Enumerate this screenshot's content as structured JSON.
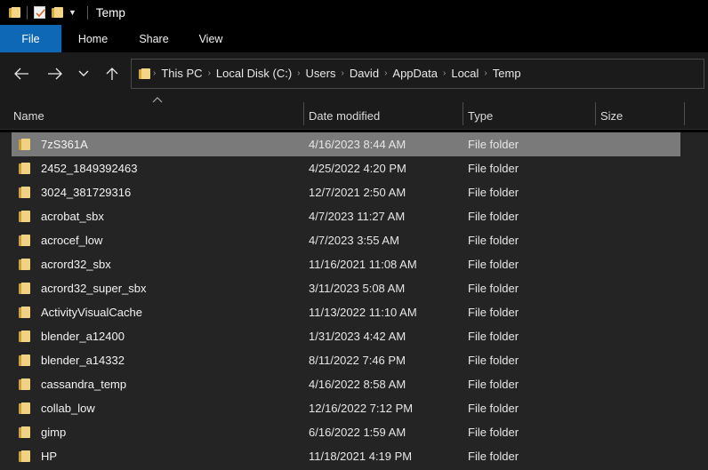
{
  "titlebar": {
    "title": "Temp",
    "quick_access": [
      {
        "icon": "folder-icon",
        "name": "explorer-app-icon"
      },
      {
        "icon": "properties-icon",
        "name": "properties-quick-access"
      },
      {
        "icon": "folder-icon",
        "name": "new-folder-quick-access"
      },
      {
        "icon": "chevron-down-icon",
        "name": "customize-quick-access"
      }
    ]
  },
  "ribbon": {
    "tabs": [
      {
        "label": "File",
        "active": true
      },
      {
        "label": "Home",
        "active": false
      },
      {
        "label": "Share",
        "active": false
      },
      {
        "label": "View",
        "active": false
      }
    ],
    "accent_color": "#0f68b5"
  },
  "navigation": {
    "back_icon": "arrow-left-icon",
    "forward_icon": "arrow-right-icon",
    "recent_icon": "chevron-down-icon",
    "up_icon": "arrow-up-icon",
    "breadcrumbs": [
      "This PC",
      "Local Disk (C:)",
      "Users",
      "David",
      "AppData",
      "Local",
      "Temp"
    ],
    "separator": "›"
  },
  "columns": [
    {
      "label": "Name",
      "sorted": "ascending",
      "sort_glyph": "˄"
    },
    {
      "label": "Date modified",
      "sorted": null
    },
    {
      "label": "Type",
      "sorted": null
    },
    {
      "label": "Size",
      "sorted": null
    }
  ],
  "files": [
    {
      "name": "7zS361A",
      "date": "4/16/2023 8:44 AM",
      "type": "File folder",
      "size": "",
      "selected": true
    },
    {
      "name": "2452_1849392463",
      "date": "4/25/2022 4:20 PM",
      "type": "File folder",
      "size": "",
      "selected": false
    },
    {
      "name": "3024_381729316",
      "date": "12/7/2021 2:50 AM",
      "type": "File folder",
      "size": "",
      "selected": false
    },
    {
      "name": "acrobat_sbx",
      "date": "4/7/2023 11:27 AM",
      "type": "File folder",
      "size": "",
      "selected": false
    },
    {
      "name": "acrocef_low",
      "date": "4/7/2023 3:55 AM",
      "type": "File folder",
      "size": "",
      "selected": false
    },
    {
      "name": "acrord32_sbx",
      "date": "11/16/2021 11:08 AM",
      "type": "File folder",
      "size": "",
      "selected": false
    },
    {
      "name": "acrord32_super_sbx",
      "date": "3/11/2023 5:08 AM",
      "type": "File folder",
      "size": "",
      "selected": false
    },
    {
      "name": "ActivityVisualCache",
      "date": "11/13/2022 11:10 AM",
      "type": "File folder",
      "size": "",
      "selected": false
    },
    {
      "name": "blender_a12400",
      "date": "1/31/2023 4:42 AM",
      "type": "File folder",
      "size": "",
      "selected": false
    },
    {
      "name": "blender_a14332",
      "date": "8/11/2022 7:46 PM",
      "type": "File folder",
      "size": "",
      "selected": false
    },
    {
      "name": "cassandra_temp",
      "date": "4/16/2022 8:58 AM",
      "type": "File folder",
      "size": "",
      "selected": false
    },
    {
      "name": "collab_low",
      "date": "12/16/2022 7:12 PM",
      "type": "File folder",
      "size": "",
      "selected": false
    },
    {
      "name": "gimp",
      "date": "6/16/2022 1:59 AM",
      "type": "File folder",
      "size": "",
      "selected": false
    },
    {
      "name": "HP",
      "date": "11/18/2021 4:19 PM",
      "type": "File folder",
      "size": "",
      "selected": false
    }
  ]
}
